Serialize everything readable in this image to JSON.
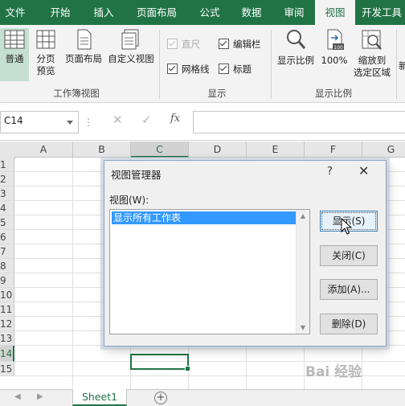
{
  "ribbon_tabs": [
    {
      "label": "文件"
    },
    {
      "label": "开始"
    },
    {
      "label": "插入"
    },
    {
      "label": "页面布局"
    },
    {
      "label": "公式"
    },
    {
      "label": "数据"
    },
    {
      "label": "审阅"
    },
    {
      "label": "视图"
    },
    {
      "label": "开发工具"
    }
  ],
  "ribbon": {
    "workbook_views": {
      "group_label": "工作簿视图",
      "normal": "普通",
      "page_break_preview": "分页\n预览",
      "page_layout": "页面布局",
      "custom_views": "自定义视图"
    },
    "show": {
      "group_label": "显示",
      "ruler": "直尺",
      "gridlines": "网格线",
      "formula_bar": "编辑栏",
      "headings": "标题"
    },
    "zoom": {
      "group_label": "显示比例",
      "zoom": "显示比例",
      "zoom_100": "100%",
      "zoom_to_selection": "缩放到\n选定区域"
    },
    "partial_next": "新"
  },
  "formula_bar": {
    "name_box": "C14",
    "dots": "⋮",
    "cancel": "✕",
    "enter": "✓",
    "fx": "fx"
  },
  "grid": {
    "columns": [
      "A",
      "B",
      "C",
      "D",
      "E",
      "F",
      "G"
    ],
    "rows": [
      "1",
      "2",
      "3",
      "4",
      "5",
      "6",
      "7",
      "8",
      "9",
      "10",
      "11",
      "12",
      "13",
      "14",
      "15"
    ],
    "selected_column": "C",
    "selected_row": "14"
  },
  "sheets": {
    "tabs": [
      "Sheet1"
    ],
    "add": "+",
    "nav_prev": "◀",
    "nav_next": "▶"
  },
  "dialog": {
    "title": "视图管理器",
    "help": "?",
    "close": "✕",
    "views_label": "视图(W):",
    "views": [
      "显示所有工作表"
    ],
    "buttons": {
      "show": "显示(S)",
      "close": "关闭(C)",
      "add": "添加(A)...",
      "delete": "删除(D)"
    }
  },
  "watermark": "Bai 经验",
  "colors": {
    "excel_green": "#217346",
    "selection_blue": "#3399ff"
  }
}
